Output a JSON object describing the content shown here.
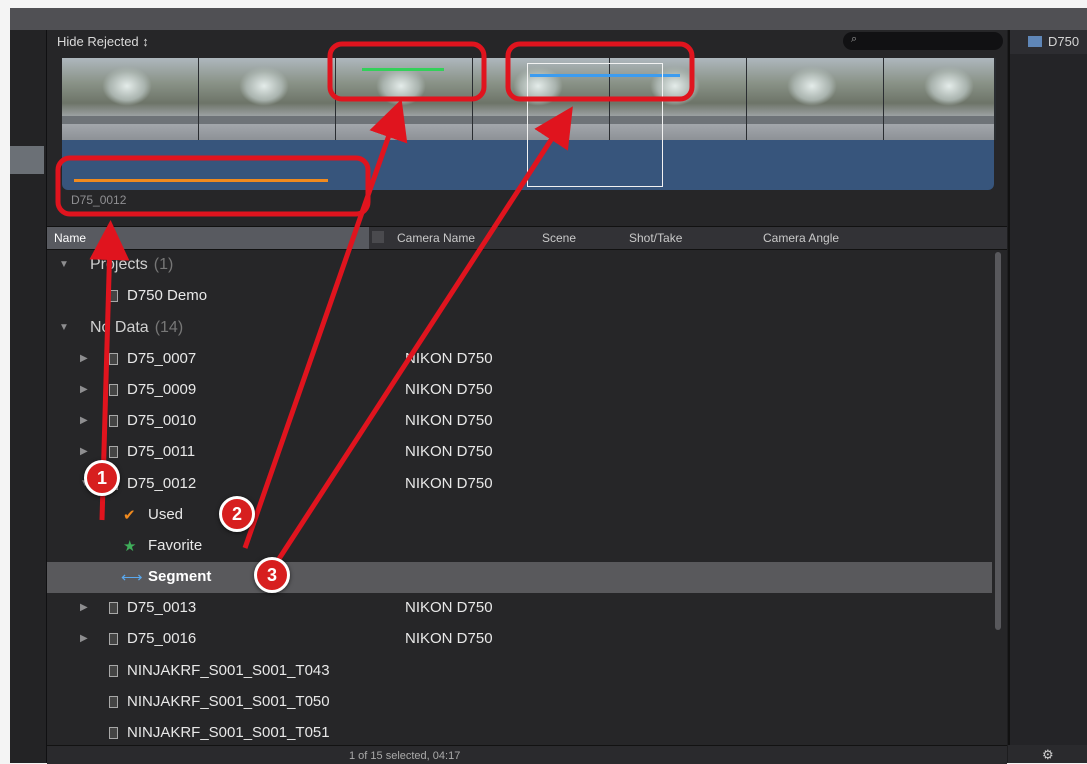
{
  "browser": {
    "filter_label": "Hide Rejected ↕",
    "search_icon": "⌕",
    "clip_label": "D75_0012"
  },
  "list_header": {
    "columns": [
      "Name",
      "Camera Name",
      "Scene",
      "Shot/Take",
      "Camera Angle"
    ]
  },
  "rows": {
    "projects": {
      "label": "Projects",
      "count": "(1)"
    },
    "demo": {
      "label": "D750 Demo"
    },
    "nodata": {
      "label": "No Data",
      "count": "(14)"
    },
    "clip_0007": {
      "label": "D75_0007",
      "camera": "NIKON D750"
    },
    "clip_0009": {
      "label": "D75_0009",
      "camera": "NIKON D750"
    },
    "clip_0010": {
      "label": "D75_0010",
      "camera": "NIKON D750"
    },
    "clip_0011": {
      "label": "D75_0011",
      "camera": "NIKON D750"
    },
    "clip_0012": {
      "label": "D75_0012",
      "camera": "NIKON D750"
    },
    "used": {
      "label": "Used",
      "icon": "✔"
    },
    "favorite": {
      "label": "Favorite",
      "icon": "★"
    },
    "segment": {
      "label": "Segment",
      "icon": "⟷"
    },
    "clip_0013": {
      "label": "D75_0013",
      "camera": "NIKON D750"
    },
    "clip_0016": {
      "label": "D75_0016",
      "camera": "NIKON D750"
    },
    "ninja_t043": {
      "label": "NINJAKRF_S001_S001_T043"
    },
    "ninja_t050": {
      "label": "NINJAKRF_S001_S001_T050"
    },
    "ninja_t051": {
      "label": "NINJAKRF_S001_S001_T051"
    }
  },
  "status": {
    "text": "1 of 15 selected, 04:17"
  },
  "right_panel": {
    "title": "D750"
  },
  "callouts": [
    "1",
    "2",
    "3"
  ],
  "colors": {
    "annotation_red": "#e0141e",
    "favorite_range": "#33d05a",
    "keyword_range": "#3c9cf0",
    "used_range": "#f08a1e"
  }
}
